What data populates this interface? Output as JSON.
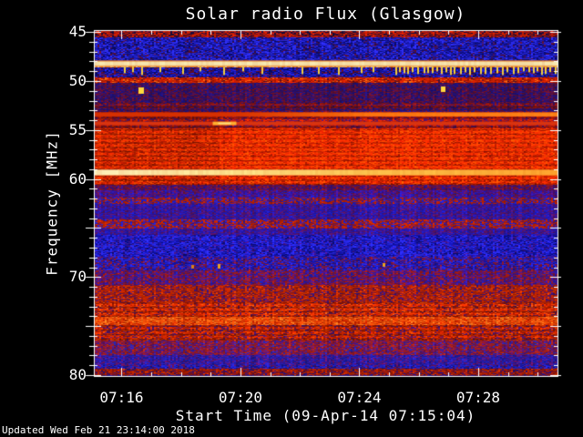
{
  "labels": {
    "title": "Solar radio Flux (Glasgow)",
    "ylabel": "Frequency [MHz]",
    "xlabel": "Start Time (09-Apr-14 07:15:04)",
    "updated": "Updated Wed Feb 21 23:14:00 2018"
  },
  "chart_data": {
    "type": "heatmap",
    "title": "Solar radio Flux (Glasgow)",
    "xlabel": "Start Time (09-Apr-14 07:15:04)",
    "ylabel": "Frequency [MHz]",
    "observatory": "Glasgow",
    "start_time": "09-Apr-14 07:15:04",
    "x_span_seconds": 936,
    "x_ticks": [
      {
        "t": 56,
        "label": "07:16"
      },
      {
        "t": 296,
        "label": "07:20"
      },
      {
        "t": 536,
        "label": "07:24"
      },
      {
        "t": 776,
        "label": "07:28"
      }
    ],
    "x_minor_interval_seconds": 60,
    "ylim": [
      44.8,
      80.1
    ],
    "y_axis_inverted": true,
    "y_ticks": [
      {
        "f": 45,
        "label": "45"
      },
      {
        "f": 50,
        "label": "50"
      },
      {
        "f": 55,
        "label": "55"
      },
      {
        "f": 60,
        "label": "60"
      },
      {
        "f": 70,
        "label": "70"
      },
      {
        "f": 80,
        "label": "80"
      }
    ],
    "y_unlabeled_major_ticks": [
      65,
      75
    ],
    "y_minor_interval_mhz": 1,
    "frame_color": "#ffffff",
    "background": "#000000",
    "bands": [
      {
        "f0": 44.5,
        "f1": 45.5,
        "colors": [
          "#c81e00",
          "#7a1020",
          "#1a0b3a"
        ],
        "weights": [
          0.45,
          0.3,
          0.25
        ]
      },
      {
        "f0": 45.5,
        "f1": 47.95,
        "colors": [
          "#2a2ae6",
          "#1616aa",
          "#0b0b6e",
          "#5a1030"
        ],
        "weights": [
          0.35,
          0.35,
          0.2,
          0.1
        ]
      },
      {
        "f0": 47.95,
        "f1": 48.55,
        "colors": [
          "#e87818",
          "#f8ecb4"
        ],
        "weights": [
          0.5,
          0.5
        ]
      },
      {
        "f0": 48.55,
        "f1": 49.6,
        "colors": [
          "#2222d8",
          "#12129a",
          "#0a0a60",
          "#701025"
        ],
        "weights": [
          0.3,
          0.3,
          0.2,
          0.2
        ]
      },
      {
        "f0": 49.6,
        "f1": 50.1,
        "colors": [
          "#d42200",
          "#a81500",
          "#f06010",
          "#501030"
        ],
        "weights": [
          0.5,
          0.25,
          0.15,
          0.1
        ]
      },
      {
        "f0": 50.1,
        "f1": 52.15,
        "colors": [
          "#4a1048",
          "#2a1070",
          "#701028",
          "#1a1280"
        ],
        "weights": [
          0.3,
          0.25,
          0.25,
          0.2
        ]
      },
      {
        "f0": 52.15,
        "f1": 52.7,
        "colors": [
          "#8c1410",
          "#5a1038",
          "#30106a"
        ],
        "weights": [
          0.45,
          0.3,
          0.25
        ],
        "striate": true
      },
      {
        "f0": 52.7,
        "f1": 53.15,
        "colors": [
          "#4a1048",
          "#2a1070",
          "#701028",
          "#1a1280"
        ],
        "weights": [
          0.3,
          0.25,
          0.25,
          0.2
        ]
      },
      {
        "f0": 53.15,
        "f1": 53.65,
        "colors": [
          "#a01800",
          "#701020"
        ],
        "weights": [
          0.5,
          0.5
        ]
      },
      {
        "f0": 53.65,
        "f1": 54.75,
        "colors": [
          "#b01c00",
          "#801018",
          "#481050"
        ],
        "weights": [
          0.4,
          0.35,
          0.25
        ],
        "striate": true
      },
      {
        "f0": 54.75,
        "f1": 59.1,
        "colors": [
          "#d42600",
          "#a81800",
          "#ec3c00"
        ],
        "weights": [
          0.45,
          0.3,
          0.25
        ],
        "striate": true
      },
      {
        "f0": 59.1,
        "f1": 59.6,
        "colors": [
          "#d42600",
          "#ec3c00"
        ],
        "weights": [
          0.5,
          0.5
        ]
      },
      {
        "f0": 59.6,
        "f1": 60.5,
        "colors": [
          "#cc2200",
          "#981400",
          "#e84400"
        ],
        "weights": [
          0.5,
          0.3,
          0.2
        ],
        "striate": true
      },
      {
        "f0": 60.5,
        "f1": 61.1,
        "colors": [
          "#801428",
          "#501060",
          "#28128a"
        ],
        "weights": [
          0.4,
          0.35,
          0.25
        ]
      },
      {
        "f0": 61.1,
        "f1": 61.8,
        "colors": [
          "#3a14a0",
          "#5a1070",
          "#1c1cc0",
          "#701838"
        ],
        "weights": [
          0.35,
          0.3,
          0.2,
          0.15
        ]
      },
      {
        "f0": 61.8,
        "f1": 62.45,
        "colors": [
          "#b82000",
          "#2020c8",
          "#501878"
        ],
        "weights": [
          0.4,
          0.3,
          0.3
        ]
      },
      {
        "f0": 62.45,
        "f1": 64.05,
        "colors": [
          "#32149c",
          "#1c1cc2",
          "#5a1468"
        ],
        "weights": [
          0.35,
          0.3,
          0.35
        ]
      },
      {
        "f0": 64.05,
        "f1": 65.0,
        "colors": [
          "#c02400",
          "#2222cc",
          "#6a1458"
        ],
        "weights": [
          0.45,
          0.25,
          0.3
        ]
      },
      {
        "f0": 65.0,
        "f1": 65.7,
        "colors": [
          "#32149c",
          "#1c1cc2",
          "#5a1468"
        ],
        "weights": [
          0.35,
          0.3,
          0.35
        ]
      },
      {
        "f0": 65.7,
        "f1": 67.85,
        "colors": [
          "#2828e8",
          "#1414b0",
          "#0c0c78",
          "#4a148a"
        ],
        "weights": [
          0.4,
          0.3,
          0.15,
          0.15
        ]
      },
      {
        "f0": 67.85,
        "f1": 69.25,
        "colors": [
          "#2424d8",
          "#1212a0",
          "#8c1828",
          "#4a1478"
        ],
        "weights": [
          0.35,
          0.25,
          0.2,
          0.2
        ]
      },
      {
        "f0": 69.25,
        "f1": 70.8,
        "colors": [
          "#7a1640",
          "#40149a",
          "#a81c10",
          "#2020b0"
        ],
        "weights": [
          0.35,
          0.3,
          0.2,
          0.15
        ]
      },
      {
        "f0": 70.8,
        "f1": 72.5,
        "colors": [
          "#b82200",
          "#7a1430",
          "#d83800",
          "#3a1480"
        ],
        "weights": [
          0.45,
          0.25,
          0.15,
          0.15
        ]
      },
      {
        "f0": 72.5,
        "f1": 74.05,
        "colors": [
          "#d82c00",
          "#a81800",
          "#f05010",
          "#5a1448"
        ],
        "weights": [
          0.45,
          0.25,
          0.15,
          0.15
        ],
        "striate": true
      },
      {
        "f0": 74.05,
        "f1": 74.85,
        "colors": [
          "#ec4c08",
          "#c82400",
          "#f87820"
        ],
        "weights": [
          0.5,
          0.3,
          0.2
        ]
      },
      {
        "f0": 74.85,
        "f1": 76.4,
        "colors": [
          "#cc2600",
          "#981600",
          "#e04000",
          "#4a1468"
        ],
        "weights": [
          0.4,
          0.25,
          0.15,
          0.2
        ],
        "striate": true
      },
      {
        "f0": 76.4,
        "f1": 77.9,
        "colors": [
          "#8c1830",
          "#5a1478",
          "#b02410",
          "#2828b8"
        ],
        "weights": [
          0.35,
          0.3,
          0.2,
          0.15
        ]
      },
      {
        "f0": 77.9,
        "f1": 78.9,
        "colors": [
          "#2a20b8",
          "#1a1a9a",
          "#6a1468",
          "#3a148c"
        ],
        "weights": [
          0.35,
          0.25,
          0.25,
          0.15
        ]
      },
      {
        "f0": 78.9,
        "f1": 79.3,
        "colors": [
          "#2222cc",
          "#14148a",
          "#6a1450"
        ],
        "weights": [
          0.45,
          0.3,
          0.25
        ]
      },
      {
        "f0": 79.3,
        "f1": 80.0,
        "colors": [
          "#a81c00",
          "#701028",
          "#c83000",
          "#28107a"
        ],
        "weights": [
          0.4,
          0.3,
          0.15,
          0.15
        ]
      },
      {
        "f0": 80.0,
        "f1": 80.6,
        "colors": [
          "#4a1058",
          "#1a1488",
          "#701828"
        ],
        "weights": [
          0.4,
          0.35,
          0.25
        ]
      }
    ],
    "steps": [
      {
        "t": 252,
        "f0": 53.0,
        "f1": 60.4,
        "gain": 1.16
      }
    ],
    "features": [
      {
        "type": "solid_band",
        "f0": 47.9,
        "f1": 48.55,
        "stops": [
          "#e87818",
          "#f8ecb4",
          "#f8ecb4",
          "#e87818"
        ]
      },
      {
        "type": "bright_line",
        "f0": 59.05,
        "f1": 59.62,
        "stops": [
          "#fff4c0",
          "#ffe890",
          "#ffc850",
          "#ffa830"
        ]
      },
      {
        "type": "bright_line",
        "f0": 53.2,
        "f1": 53.62,
        "stops": [
          "#d83000",
          "#d83000",
          "#ff7710",
          "#ff8618"
        ]
      },
      {
        "type": "line_blob",
        "f0": 54.15,
        "f1": 54.5,
        "color": "#d83410",
        "blob_t": 240,
        "blob_len": 26,
        "blob_color": "#ffb030"
      },
      {
        "type": "rfi_comb",
        "f0": 48.55,
        "f1": 49.4,
        "color": "#f0cc3c",
        "sparse_times": [
          60,
          78,
          96,
          132,
          178,
          214,
          262,
          300,
          338,
          420,
          452,
          492,
          538,
          562
        ],
        "dense_from": 608,
        "dense_to": 930,
        "dense_step": 10
      },
      {
        "type": "dot",
        "t": 96,
        "f": 51.0,
        "color": "#ffd83c",
        "w": 6,
        "h": 7
      },
      {
        "type": "dot",
        "t": 706,
        "f": 50.8,
        "color": "#ffd83c",
        "w": 5,
        "h": 6
      },
      {
        "type": "dot",
        "t": 200,
        "f": 68.95,
        "color": "#d88018",
        "w": 3,
        "h": 4
      },
      {
        "type": "dot",
        "t": 252,
        "f": 68.9,
        "color": "#e8a020",
        "w": 3,
        "h": 5
      },
      {
        "type": "dot",
        "t": 585,
        "f": 68.8,
        "color": "#e8a020",
        "w": 3,
        "h": 4
      }
    ]
  }
}
